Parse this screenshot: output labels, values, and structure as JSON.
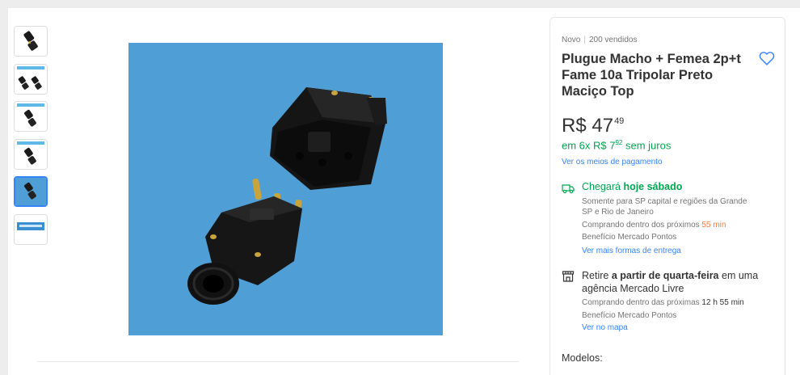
{
  "gallery": {
    "thumbnails": [
      {
        "name": "thumbnail-1",
        "label": ""
      },
      {
        "name": "thumbnail-2",
        "label": ""
      },
      {
        "name": "thumbnail-3",
        "label": ""
      },
      {
        "name": "thumbnail-4",
        "label": ""
      },
      {
        "name": "thumbnail-5",
        "label": ""
      },
      {
        "name": "thumbnail-6",
        "label": ""
      }
    ],
    "active_index": 4
  },
  "product": {
    "condition": "Novo",
    "separator": "|",
    "sold": "200 vendidos",
    "title": "Plugue Macho + Femea 2p+t Fame 10a Tripolar Preto Maciço Top",
    "price_currency": "R$",
    "price_integer": "47",
    "price_cents": "49",
    "installments_prefix": "em ",
    "installments_main": "6x R$ 7",
    "installments_cents": "92",
    "installments_suffix": " sem juros",
    "payment_link": "Ver os meios de pagamento"
  },
  "shipping": {
    "title_prefix": "Chegará ",
    "title_bold": "hoje sábado",
    "line1": "Somente para SP capital e regiões da Grande",
    "line2": "SP e Rio de Janeiro",
    "line3_prefix": "Comprando dentro dos próximos ",
    "line3_highlight": "55 min",
    "line4": "Benefício Mercado Pontos",
    "link": "Ver mais formas de entrega"
  },
  "pickup": {
    "prefix": "Retire ",
    "bold": "a partir de quarta-feira",
    "suffix": " em uma agência Mercado Livre",
    "line1_prefix": "Comprando dentro das próximas ",
    "line1_time": "12 h 55 min",
    "line2": "Benefício Mercado Pontos",
    "link": "Ver no mapa"
  },
  "models": {
    "label": "Modelos:"
  },
  "colors": {
    "accent_blue": "#3483fa",
    "green": "#00a650",
    "orange": "#ff7733",
    "image_bg": "#4f9fd6"
  }
}
